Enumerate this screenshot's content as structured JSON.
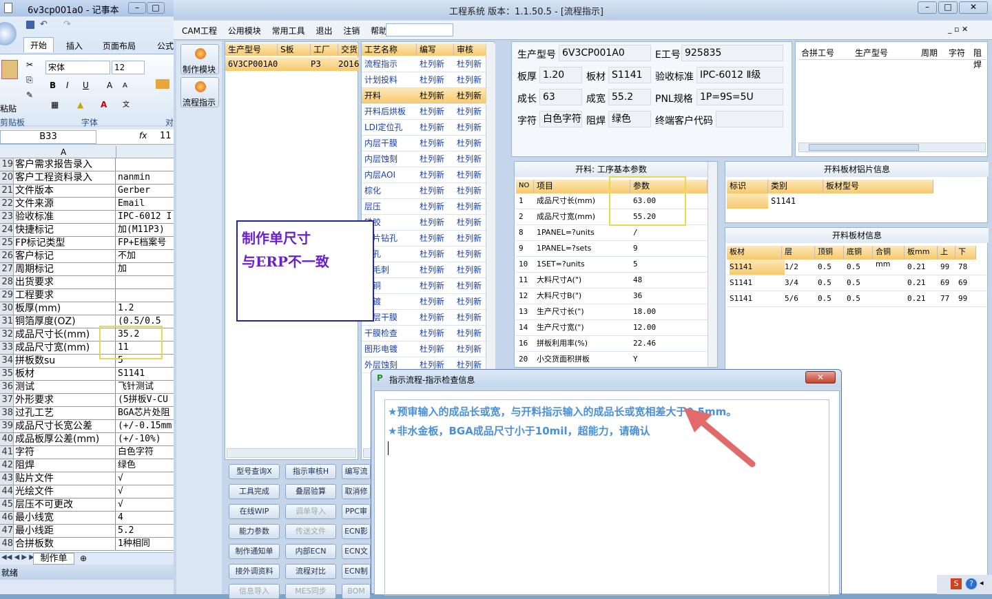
{
  "notepad": {
    "title": "6v3cp001a0 - 记事本"
  },
  "excel": {
    "tabs": [
      "开始",
      "插入",
      "页面布局",
      "公式"
    ],
    "font": "宋体",
    "size": "12",
    "paste": "粘贴",
    "clipboard": "剪贴板",
    "font_group": "字体",
    "align_group": "对",
    "namebox": "B33",
    "fx": "fx",
    "formula": "11",
    "col_a": "A",
    "rows": [
      {
        "n": "19",
        "a": "客户需求报告录入",
        "b": ""
      },
      {
        "n": "20",
        "a": "客户工程资料录入",
        "b": "nanmin"
      },
      {
        "n": "21",
        "a": "文件版本",
        "b": "Gerber"
      },
      {
        "n": "22",
        "a": "文件来源",
        "b": "Email"
      },
      {
        "n": "23",
        "a": "验收标准",
        "b": "IPC-6012 I"
      },
      {
        "n": "24",
        "a": "快捷标记",
        "b": "加(M11P3)"
      },
      {
        "n": "25",
        "a": "FP标记类型",
        "b": "FP+E档案号"
      },
      {
        "n": "26",
        "a": "客户标记",
        "b": "不加"
      },
      {
        "n": "27",
        "a": "周期标记",
        "b": "加"
      },
      {
        "n": "28",
        "a": "出货要求",
        "b": ""
      },
      {
        "n": "29",
        "a": "工程要求",
        "b": ""
      },
      {
        "n": "30",
        "a": "板厚(mm)",
        "b": "1.2"
      },
      {
        "n": "31",
        "a": "铜箔厚度(OZ)",
        "b": "(0.5/0.5"
      },
      {
        "n": "32",
        "a": "成品尺寸长(mm)",
        "b": "35.2"
      },
      {
        "n": "33",
        "a": "成品尺寸宽(mm)",
        "b": "11"
      },
      {
        "n": "34",
        "a": "拼板数su",
        "b": "5"
      },
      {
        "n": "35",
        "a": "板材",
        "b": "S1141"
      },
      {
        "n": "36",
        "a": "测试",
        "b": "飞针测试"
      },
      {
        "n": "37",
        "a": "外形要求",
        "b": "(5拼板V-CU"
      },
      {
        "n": "38",
        "a": "过孔工艺",
        "b": "BGA芯片处阻"
      },
      {
        "n": "39",
        "a": "成品尺寸长宽公差",
        "b": "(+/-0.15mm"
      },
      {
        "n": "40",
        "a": "成品板厚公差(mm)",
        "b": "(+/-10%)"
      },
      {
        "n": "41",
        "a": "字符",
        "b": "白色字符"
      },
      {
        "n": "42",
        "a": "阻焊",
        "b": "绿色"
      },
      {
        "n": "43",
        "a": "贴片文件",
        "b": "√"
      },
      {
        "n": "44",
        "a": "光绘文件",
        "b": "√"
      },
      {
        "n": "45",
        "a": "层压不可更改",
        "b": "√"
      },
      {
        "n": "46",
        "a": "最小线宽",
        "b": "4"
      },
      {
        "n": "47",
        "a": "最小线距",
        "b": "5.2"
      },
      {
        "n": "48",
        "a": "合拼板数",
        "b": "1种相同"
      }
    ],
    "sheet_tab": "制作单",
    "status": "就绪"
  },
  "app": {
    "title": "工程系统   版本：1.1.50.5 - [流程指示]",
    "menus": [
      "CAM工程",
      "公用模块",
      "常用工具",
      "退出",
      "注销",
      "帮助"
    ],
    "side_buttons": [
      "制作模块",
      "流程指示"
    ],
    "model_table": {
      "headers": [
        "生产型号",
        "S板",
        "工厂",
        "交货"
      ],
      "row": [
        "6V3CP001A0",
        "",
        "P3",
        "2016"
      ]
    },
    "process_table": {
      "headers": [
        "工艺名称",
        "编写",
        "审核"
      ],
      "rows": [
        [
          "流程指示",
          "杜列新",
          "杜列新"
        ],
        [
          "计划投料",
          "杜列新",
          "杜列新"
        ],
        [
          "开料",
          "杜列新",
          "杜列新"
        ],
        [
          "开料后烘板",
          "杜列新",
          "杜列新"
        ],
        [
          "LDI定位孔",
          "杜列新",
          "杜列新"
        ],
        [
          "内层干膜",
          "杜列新",
          "杜列新"
        ],
        [
          "内层蚀刻",
          "杜列新",
          "杜列新"
        ],
        [
          "内层AOI",
          "杜列新",
          "杜列新"
        ],
        [
          "棕化",
          "杜列新",
          "杜列新"
        ],
        [
          "层压",
          "杜列新",
          "杜列新"
        ],
        [
          "铣胶",
          "杜列新",
          "杜列新"
        ],
        [
          "芯片钻孔",
          "杜列新",
          "杜列新"
        ],
        [
          "沉孔",
          "杜列新",
          "杜列新"
        ],
        [
          "去毛刺",
          "杜列新",
          "杜列新"
        ],
        [
          "沉铜",
          "杜列新",
          "杜列新"
        ],
        [
          "板镀",
          "杜列新",
          "杜列新"
        ],
        [
          "外层干膜",
          "杜列新",
          "杜列新"
        ],
        [
          "干膜检查",
          "杜列新",
          "杜列新"
        ],
        [
          "图形电镀",
          "杜列新",
          "杜列新"
        ],
        [
          "外层蚀刻",
          "杜列新",
          "杜列新"
        ]
      ]
    },
    "buttons": [
      [
        "型号查询X",
        "指示审核H",
        "编写流"
      ],
      [
        "工具完成",
        "叠层验算",
        "取消修"
      ],
      [
        "在线WIP",
        "调单导入",
        "PPC审"
      ],
      [
        "能力参数",
        "传送文件",
        "ECN影"
      ],
      [
        "制作通知单",
        "内部ECN",
        "ECN文"
      ],
      [
        "接外调资料",
        "流程对比",
        "ECN制"
      ],
      [
        "信息导入",
        "MES同步",
        "BOM"
      ]
    ],
    "info": {
      "model_lbl": "生产型号",
      "model": "6V3CP001A0",
      "e_lbl": "E工号",
      "e": "925835",
      "thick_lbl": "板厚",
      "thick": "1.20",
      "mat_lbl": "板材",
      "mat": "S1141",
      "std_lbl": "验收标准",
      "std": "IPC-6012 Ⅱ级",
      "len_lbl": "成长",
      "len": "63",
      "wid_lbl": "成宽",
      "wid": "55.2",
      "pnl_lbl": "PNL规格",
      "pnl": "1P=9S=5U",
      "char_lbl": "字符",
      "char": "白色字符",
      "mask_lbl": "阻焊",
      "mask": "绿色",
      "cust_lbl": "终端客户代码",
      "cust": ""
    },
    "merge_headers": [
      "合拼工号",
      "生产型号",
      "周期",
      "字符",
      "阻焊"
    ],
    "params": {
      "title": "开料: 工序基本参数",
      "headers": [
        "NO",
        "项目",
        "参数"
      ],
      "rows": [
        [
          "1",
          "成品尺寸长(mm)",
          "63.00"
        ],
        [
          "2",
          "成品尺寸宽(mm)",
          "55.20"
        ],
        [
          "8",
          "1PANEL=?units",
          "/"
        ],
        [
          "9",
          "1PANEL=?sets",
          "9"
        ],
        [
          "10",
          "1SET=?units",
          "5"
        ],
        [
          "11",
          "大料尺寸A(\")",
          "48"
        ],
        [
          "12",
          "大料尺寸B(\")",
          "36"
        ],
        [
          "13",
          "生产尺寸长(\")",
          "18.00"
        ],
        [
          "14",
          "生产尺寸宽(\")",
          "12.00"
        ],
        [
          "16",
          "拼板利用率(%)",
          "22.46"
        ],
        [
          "20",
          "小交货面积拼板",
          "Y"
        ]
      ]
    },
    "alu": {
      "title": "开料板材铝片信息",
      "headers": [
        "标识",
        "类别",
        "板材型号"
      ],
      "row": [
        "",
        "S1141",
        ""
      ]
    },
    "board": {
      "title": "开料板材信息",
      "headers": [
        "板材",
        "层",
        "顶铜",
        "底铜",
        "合铜mm",
        "板mm",
        "上",
        "下"
      ],
      "rows": [
        [
          "S1141",
          "1/2",
          "0.5",
          "0.5",
          "",
          "0.21",
          "99",
          "78"
        ],
        [
          "S1141",
          "3/4",
          "0.5",
          "0.5",
          "",
          "0.21",
          "69",
          "69"
        ],
        [
          "S1141",
          "5/6",
          "0.5",
          "0.5",
          "",
          "0.21",
          "77",
          "99"
        ]
      ]
    }
  },
  "annotation": {
    "line1": "制作单尺寸",
    "line2": "与ERP不一致"
  },
  "dialog": {
    "title": "指示流程-指示检查信息",
    "msg1": "★预审输入的成品长或宽，与开料指示输入的成品长或宽相差大于0.5mm。",
    "msg2": "★非水金板，BGA成品尺寸小于10mil，超能力，请确认"
  },
  "colors": {
    "accent": "#f7c96e",
    "annotation": "#6a20c8",
    "arrow": "#e36a6a",
    "message": "#4a90d9",
    "highlight": "#e6d94a"
  }
}
